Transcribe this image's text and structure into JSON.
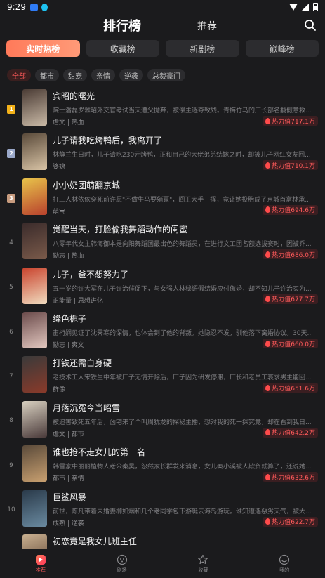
{
  "status_bar": {
    "time": "9:29"
  },
  "header": {
    "title": "排行榜",
    "recommend": "推荐"
  },
  "main_tabs": [
    {
      "label": "实时热榜"
    },
    {
      "label": "收藏榜"
    },
    {
      "label": "新剧榜"
    },
    {
      "label": "巅峰榜"
    }
  ],
  "chips": [
    {
      "label": "全部"
    },
    {
      "label": "都市"
    },
    {
      "label": "甜宠"
    },
    {
      "label": "亲情"
    },
    {
      "label": "逆袭"
    },
    {
      "label": "总裁豪门"
    }
  ],
  "items": [
    {
      "rank": "1",
      "title": "宾昭的曙光",
      "desc": "院士潘磊罗雅昭外交官考试当天遭父抛弃，被偿主逐夺致残。青梅竹马的厂长部名翻假意救...",
      "tags": "虐文 | 热血",
      "heat": "热力值717.1万",
      "colors": [
        "#4a3b34",
        "#c9b9a6"
      ]
    },
    {
      "rank": "2",
      "title": "儿子请我吃烤鸭后，我离开了",
      "desc": "林静兰生日时，儿子请吃230元烤鸭，正和自己的大佬弟弟结嫁之时，却被儿子网红女友回...",
      "tags": "婆媳",
      "heat": "热力值710.1万",
      "colors": [
        "#5a4a3a",
        "#d8c3a5"
      ]
    },
    {
      "rank": "3",
      "title": "小小奶团萌翻京城",
      "desc": "打工人林依依穿死前许愿\"不做牛马要躺赢\"，阎王大手一挥，竟让她投胎成了京城首富林承...",
      "tags": "萌宝",
      "heat": "热力值694.6万",
      "colors": [
        "#e8c34a",
        "#b8412d"
      ]
    },
    {
      "rank": "4",
      "title": "觉醒当天，打脸偷我舞蹈动作的闺蜜",
      "desc": "八零年代女主韩海御本是向阳舞蹈团最出色的舞蹈员，在进行文工团名额选拔赛时，因被乔...",
      "tags": "励志 | 热血",
      "heat": "热力值686.0万",
      "colors": [
        "#3a2b2b",
        "#7a5a4a"
      ]
    },
    {
      "rank": "5",
      "title": "儿子，爸不想努力了",
      "desc": "五十岁的许大军在儿子许治催促下，与女强人林秘语假结婚应付傲婚，却不知儿子许治实为...",
      "tags": "正能量 | 思想进化",
      "heat": "热力值677.7万",
      "colors": [
        "#c9422c",
        "#f0dcc0"
      ]
    },
    {
      "rank": "6",
      "title": "绛色栀子",
      "desc": "宙桁娴见证了沈霁寒的深情，也体会到了他的背叛。她隐忍不发，驯他落下离婚协议。30天...",
      "tags": "励志 | 爽文",
      "heat": "热力值660.0万",
      "colors": [
        "#6a4a4a",
        "#e3c8c0"
      ]
    },
    {
      "rank": "7",
      "title": "打铁还需自身硬",
      "desc": "老技术工人宋铁生中年被厂子无情开除后，厂子因为研发停滞，厂长和老员工哀求男主能回...",
      "tags": "群像",
      "heat": "热力值651.6万",
      "colors": [
        "#3a3a3a",
        "#8a3a2a"
      ]
    },
    {
      "rank": "8",
      "title": "月落沉冤今当昭雪",
      "desc": "被追害致死五年后，凶宅来了个叫周犹龙的探秘主播，想对我的死一探究竟，却在看到我日...",
      "tags": "虐文 | 都市",
      "heat": "热力值642.2万",
      "colors": [
        "#d8d0c0",
        "#4a3a3a"
      ]
    },
    {
      "rank": "9",
      "title": "谁也抢不走女儿的第一名",
      "desc": "韩雪家中丽丽植物人老公秦昊，忽然家长群发来消息，女儿秦小溪被人欺负就算了，还说她...",
      "tags": "都市 | 亲情",
      "heat": "热力值632.6万",
      "colors": [
        "#5a4a3a",
        "#c9a070"
      ]
    },
    {
      "rank": "10",
      "title": "巨鲨风暴",
      "desc": "前世，陈凡带着未婚妻柳如烟和几个老同学包下游艇去海岛游玩。谁知遭遇惡劣天气，被大...",
      "tags": "成熟 | 逆袭",
      "heat": "热力值622.7万",
      "colors": [
        "#2a3a4a",
        "#6a8aa0"
      ]
    },
    {
      "rank": "",
      "title": "初恋竟是我女儿班主任",
      "desc": "",
      "tags": "",
      "heat": "",
      "colors": [
        "#c9b090",
        "#5a4030"
      ]
    }
  ],
  "bottom_nav": [
    {
      "label": "推荐",
      "icon": "recommend-icon"
    },
    {
      "label": "剧场",
      "icon": "theater-icon"
    },
    {
      "label": "收藏",
      "icon": "favorites-icon"
    },
    {
      "label": "我的",
      "icon": "profile-icon"
    }
  ]
}
